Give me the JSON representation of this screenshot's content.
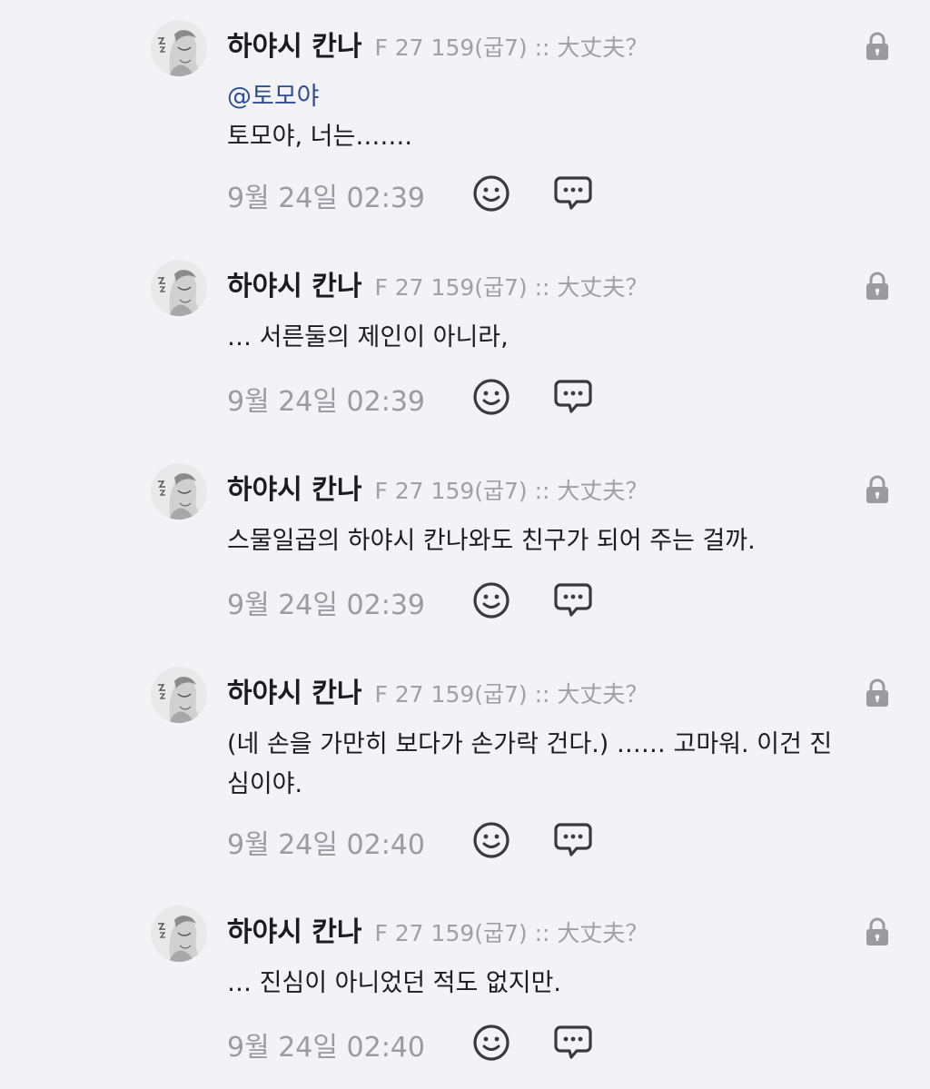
{
  "comments": [
    {
      "author": "하야시 칸나",
      "meta": "F 27 159(굽7) :: 大丈夫？",
      "mention": "@토모야",
      "lines": [
        "토모야, 너는……."
      ],
      "time": "9월 24일 02:39"
    },
    {
      "author": "하야시 칸나",
      "meta": "F 27 159(굽7) :: 大丈夫？",
      "mention": "",
      "lines": [
        "… 서른둘의 제인이 아니라,"
      ],
      "time": "9월 24일 02:39"
    },
    {
      "author": "하야시 칸나",
      "meta": "F 27 159(굽7) :: 大丈夫？",
      "mention": "",
      "lines": [
        "스물일곱의 하야시 칸나와도 친구가 되어 주는 걸까."
      ],
      "time": "9월 24일 02:39"
    },
    {
      "author": "하야시 칸나",
      "meta": "F 27 159(굽7) :: 大丈夫？",
      "mention": "",
      "lines": [
        "(네 손을 가만히 보다가 손가락 건다.) …… 고마워. 이건 진",
        "심이야."
      ],
      "time": "9월 24일 02:40"
    },
    {
      "author": "하야시 칸나",
      "meta": "F 27 159(굽7) :: 大丈夫？",
      "mention": "",
      "lines": [
        "… 진심이 아니었던 적도 없지만."
      ],
      "time": "9월 24일 02:40"
    }
  ],
  "icons": {
    "lock": "lock-icon",
    "emoji": "smiley-icon",
    "reply": "speech-bubble-icon"
  },
  "colors": {
    "background": "#f2f2f7",
    "name": "#1c1c1e",
    "meta": "#a0a0a5",
    "mention": "#2f4e92",
    "icon": "#3a3a3c"
  }
}
